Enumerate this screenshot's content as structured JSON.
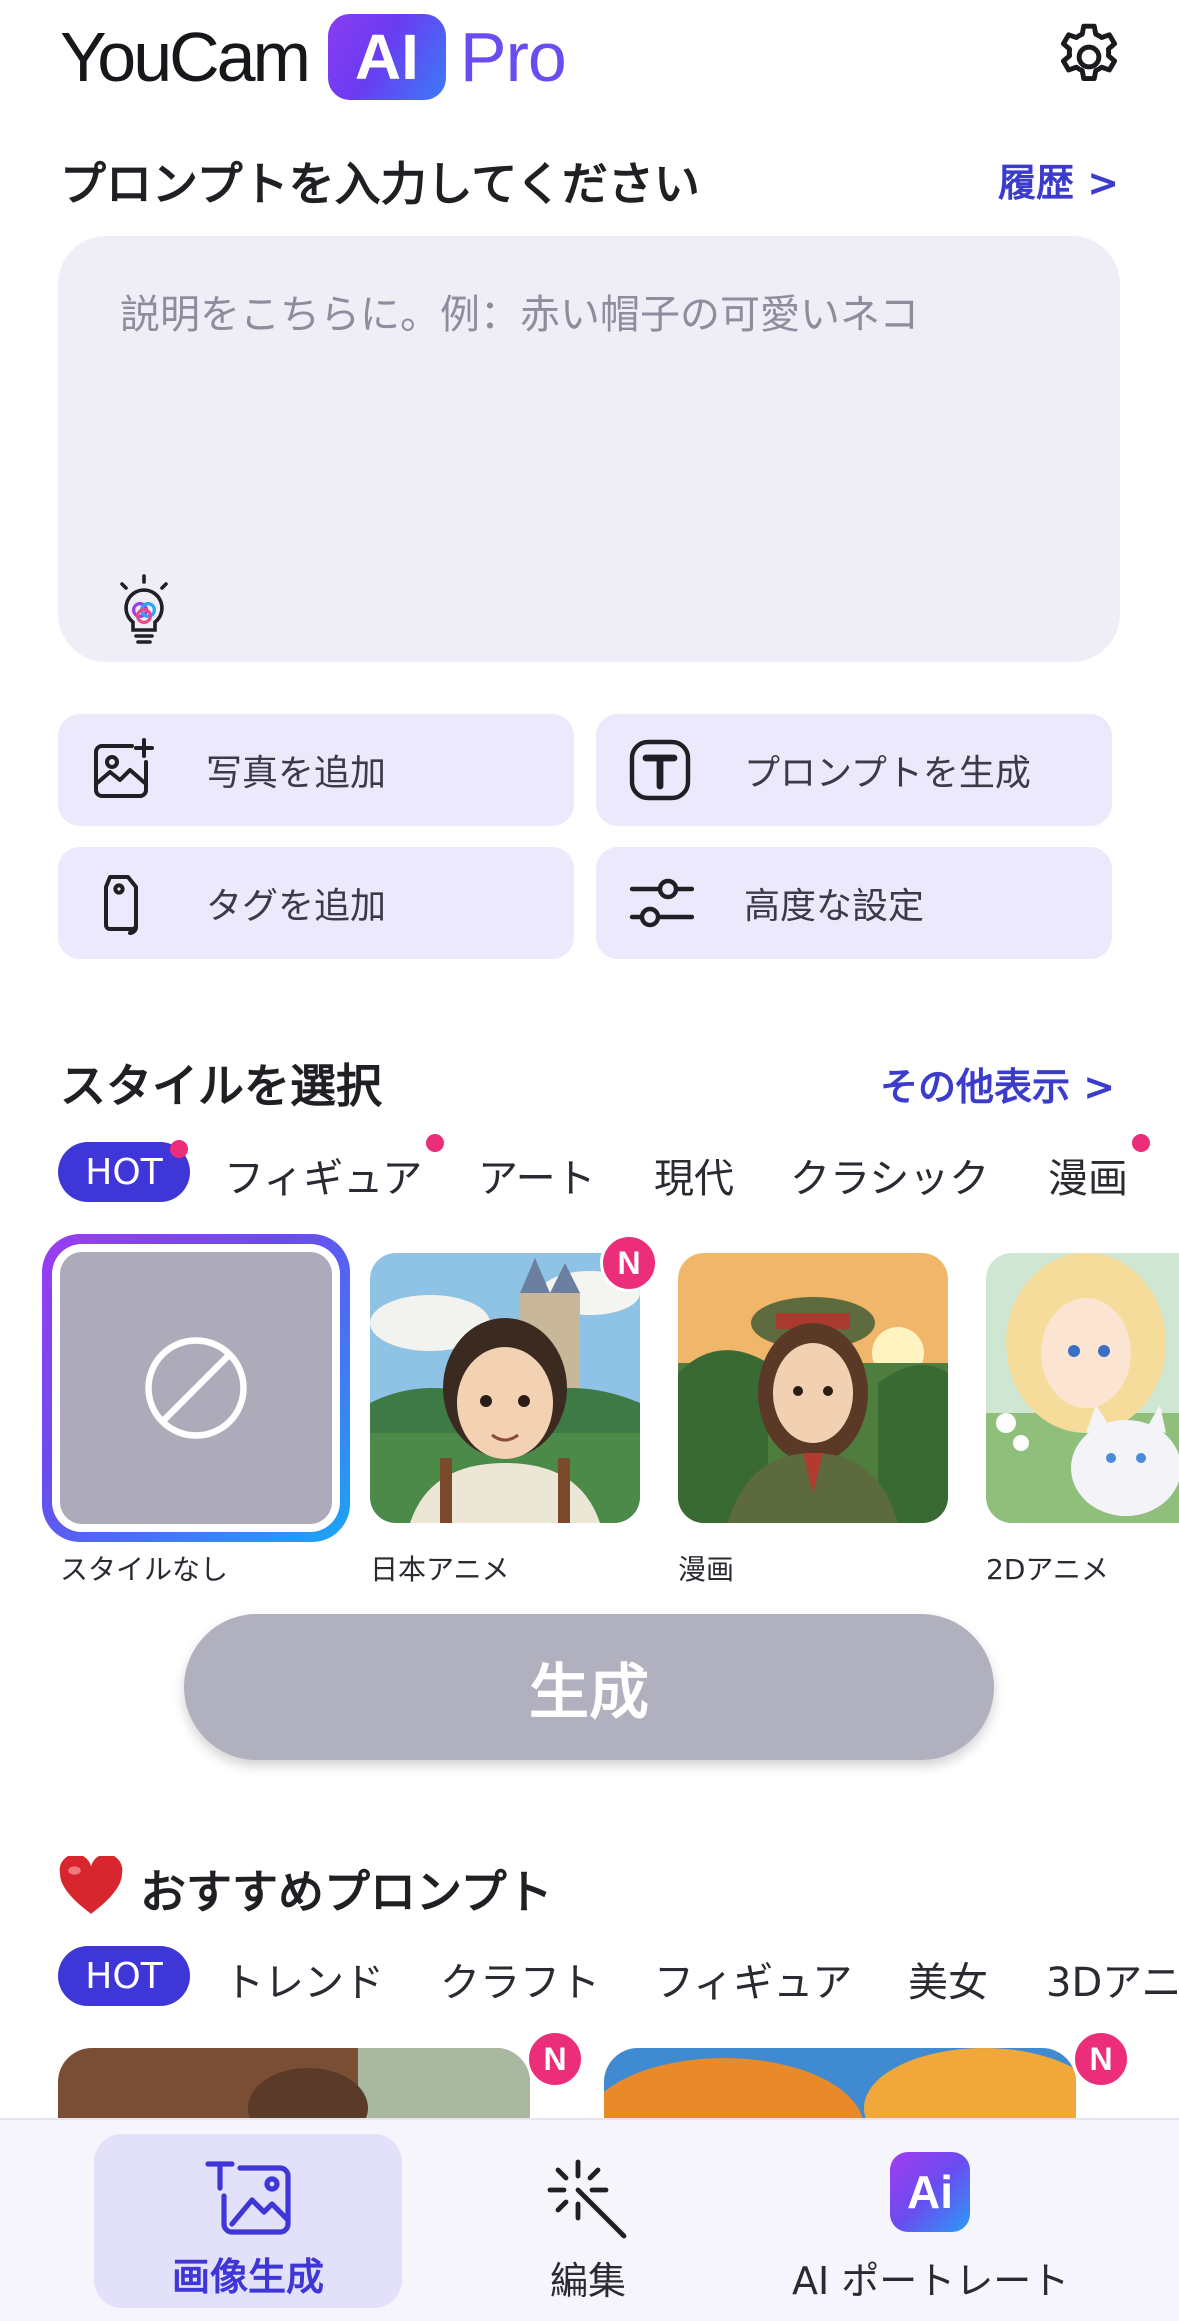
{
  "app": {
    "logo_text": "YouCam",
    "logo_badge": "AI",
    "logo_suffix": "Pro",
    "settings_icon": "gear-icon"
  },
  "prompt_section": {
    "title": "プロンプトを入力してください",
    "history_link": "履歴 >",
    "placeholder": "説明をこちらに。例：赤い帽子の可愛いネコ",
    "hint_icon": "lightbulb-icon"
  },
  "actions": [
    {
      "label": "写真を追加",
      "icon": "add-photo-icon"
    },
    {
      "label": "プロンプトを生成",
      "icon": "text-t-icon"
    },
    {
      "label": "タグを追加",
      "icon": "tag-icon"
    },
    {
      "label": "高度な設定",
      "icon": "sliders-icon"
    }
  ],
  "style_section": {
    "title": "スタイルを選択",
    "more_link": "その他表示 >",
    "tabs": [
      {
        "label": "HOT",
        "active": true,
        "new_dot": true
      },
      {
        "label": "フィギュア",
        "active": false,
        "new_dot": true
      },
      {
        "label": "アート",
        "active": false,
        "new_dot": false
      },
      {
        "label": "現代",
        "active": false,
        "new_dot": false
      },
      {
        "label": "クラシック",
        "active": false,
        "new_dot": false
      },
      {
        "label": "漫画",
        "active": false,
        "new_dot": true
      }
    ],
    "styles": [
      {
        "label": "スタイルなし",
        "selected": true,
        "badge": ""
      },
      {
        "label": "日本アニメ",
        "selected": false,
        "badge": "N"
      },
      {
        "label": "漫画",
        "selected": false,
        "badge": ""
      },
      {
        "label": "2Dアニメ",
        "selected": false,
        "badge": ""
      }
    ]
  },
  "generate_button": "生成",
  "recommended": {
    "title": "おすすめプロンプト",
    "icon": "heart-icon",
    "tabs": [
      "HOT",
      "トレンド",
      "クラフト",
      "フィギュア",
      "美女",
      "3Dアニ"
    ],
    "card_badges": [
      "N",
      "N"
    ]
  },
  "bottom_nav": [
    {
      "label": "画像生成",
      "icon": "image-generate-icon",
      "active": true
    },
    {
      "label": "編集",
      "icon": "magic-wand-icon",
      "active": false
    },
    {
      "label": "AI ポートレート",
      "icon": "ai-portrait-icon",
      "active": false
    }
  ],
  "colors": {
    "accent": "#3f36d8",
    "badge": "#ec2d7a",
    "panel": "#efeef7",
    "action_bg": "#ebe9fb",
    "disabled_button": "#b1b0bf"
  }
}
